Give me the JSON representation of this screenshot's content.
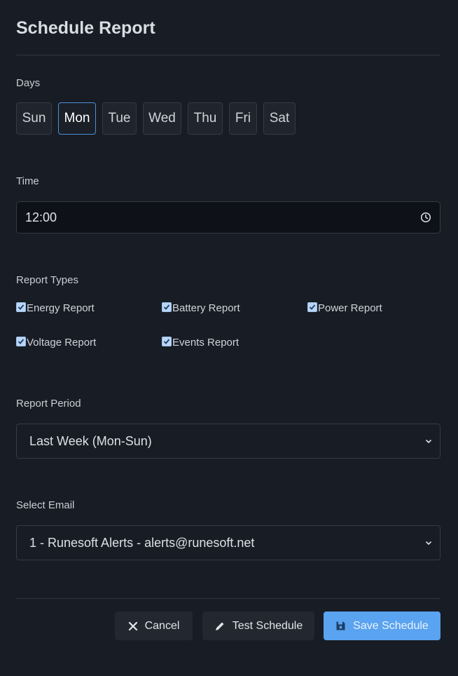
{
  "title": "Schedule Report",
  "days": {
    "label": "Days",
    "items": [
      {
        "label": "Sun",
        "active": false
      },
      {
        "label": "Mon",
        "active": true
      },
      {
        "label": "Tue",
        "active": false
      },
      {
        "label": "Wed",
        "active": false
      },
      {
        "label": "Thu",
        "active": false
      },
      {
        "label": "Fri",
        "active": false
      },
      {
        "label": "Sat",
        "active": false
      }
    ]
  },
  "time": {
    "label": "Time",
    "value": "12:00"
  },
  "report_types": {
    "label": "Report Types",
    "items": [
      {
        "label": "Energy Report",
        "checked": true
      },
      {
        "label": "Battery Report",
        "checked": true
      },
      {
        "label": "Power Report",
        "checked": true
      },
      {
        "label": "Voltage Report",
        "checked": true
      },
      {
        "label": "Events Report",
        "checked": true
      }
    ]
  },
  "report_period": {
    "label": "Report Period",
    "value": "Last Week (Mon-Sun)"
  },
  "email": {
    "label": "Select Email",
    "value": "1 - Runesoft Alerts - alerts@runesoft.net"
  },
  "buttons": {
    "cancel": "Cancel",
    "test": "Test Schedule",
    "save": "Save Schedule"
  },
  "colors": {
    "background": "#181c24",
    "accent": "#5aa3f0",
    "active_border": "#4f8fd8"
  }
}
